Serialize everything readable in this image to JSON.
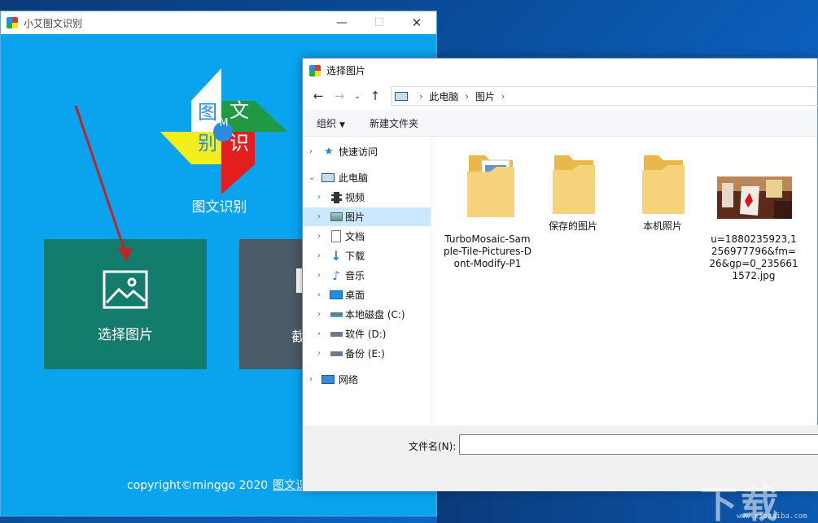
{
  "app": {
    "title": "小艾图文识别",
    "logo_chars": {
      "tl": "图",
      "tr": "文",
      "bl": "别",
      "br": "识",
      "center": "M"
    },
    "logo_caption": "图文识别",
    "tile_select_label": "选择图片",
    "tile_shot_label": "截",
    "footer_copyright": "copyright©minggo 2020",
    "footer_link": "图文识"
  },
  "dialog": {
    "title": "选择图片",
    "breadcrumb": [
      "此电脑",
      "图片"
    ],
    "toolbar": {
      "organize": "组织",
      "new_folder": "新建文件夹"
    },
    "nav": [
      {
        "label": "快速访问",
        "icon": "star-icon"
      },
      {
        "label": "此电脑",
        "icon": "computer-icon"
      },
      {
        "label": "视频",
        "icon": "video-icon"
      },
      {
        "label": "图片",
        "icon": "pictures-icon"
      },
      {
        "label": "文档",
        "icon": "document-icon"
      },
      {
        "label": "下载",
        "icon": "download-icon"
      },
      {
        "label": "音乐",
        "icon": "music-icon"
      },
      {
        "label": "桌面",
        "icon": "desktop-icon"
      },
      {
        "label": "本地磁盘 (C:)",
        "icon": "drive-icon"
      },
      {
        "label": "软件 (D:)",
        "icon": "drive-icon"
      },
      {
        "label": "备份 (E:)",
        "icon": "drive-icon"
      },
      {
        "label": "网络",
        "icon": "network-icon"
      }
    ],
    "files": [
      {
        "name": "TurboMosaic-Sample-Tile-Pictures-Dont-Modify-P1",
        "type": "folder"
      },
      {
        "name": "保存的图片",
        "type": "folder"
      },
      {
        "name": "本机照片",
        "type": "folder"
      },
      {
        "name": "u=1880235923,1256977796&fm=26&gp=0_2356611572.jpg",
        "type": "image"
      }
    ],
    "filename_label": "文件名(N):",
    "filename_value": ""
  },
  "watermark": {
    "text": "下载",
    "sub": "www.xiazaiba.com"
  },
  "colors": {
    "app_bg": "#0aa4ee",
    "tile_select": "#137c6c",
    "tile_shot": "#4a5a66",
    "nav_selected": "#cce8ff",
    "folder": "#f2c45b"
  }
}
